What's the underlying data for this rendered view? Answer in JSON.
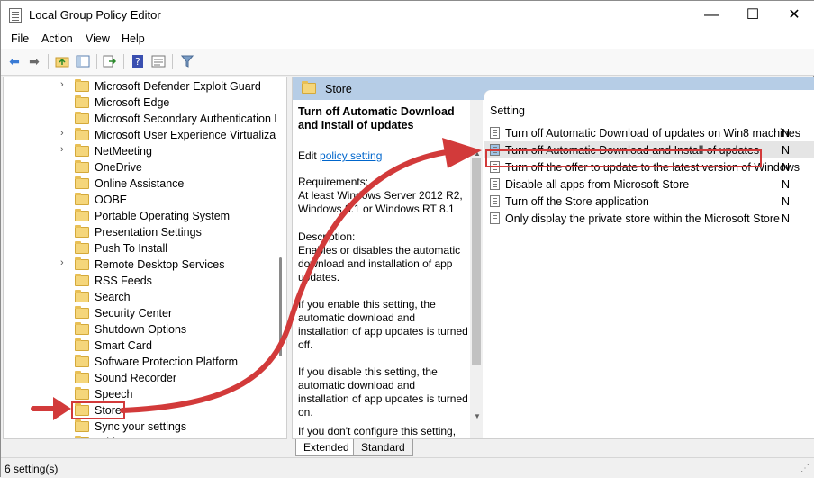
{
  "window": {
    "title": "Local Group Policy Editor",
    "min": "—",
    "max": "☐",
    "close": "✕"
  },
  "menu": [
    "File",
    "Action",
    "View",
    "Help"
  ],
  "toolbar": {
    "back": "back-arrow-icon",
    "forward": "forward-arrow-icon",
    "up": "folder-up-icon",
    "show_hide": "console-tree-icon",
    "export": "export-list-icon",
    "help": "help-icon",
    "properties": "properties-icon",
    "filter": "filter-icon"
  },
  "tree": {
    "items": [
      {
        "label": "Microsoft Defender Exploit Guard",
        "expandable": true
      },
      {
        "label": "Microsoft Edge",
        "expandable": false
      },
      {
        "label": "Microsoft Secondary Authentication F",
        "expandable": false
      },
      {
        "label": "Microsoft User Experience Virtualizati",
        "expandable": true
      },
      {
        "label": "NetMeeting",
        "expandable": true
      },
      {
        "label": "OneDrive",
        "expandable": false
      },
      {
        "label": "Online Assistance",
        "expandable": false
      },
      {
        "label": "OOBE",
        "expandable": false
      },
      {
        "label": "Portable Operating System",
        "expandable": false
      },
      {
        "label": "Presentation Settings",
        "expandable": false
      },
      {
        "label": "Push To Install",
        "expandable": false
      },
      {
        "label": "Remote Desktop Services",
        "expandable": true
      },
      {
        "label": "RSS Feeds",
        "expandable": false
      },
      {
        "label": "Search",
        "expandable": false
      },
      {
        "label": "Security Center",
        "expandable": false
      },
      {
        "label": "Shutdown Options",
        "expandable": false
      },
      {
        "label": "Smart Card",
        "expandable": false
      },
      {
        "label": "Software Protection Platform",
        "expandable": false
      },
      {
        "label": "Sound Recorder",
        "expandable": false
      },
      {
        "label": "Speech",
        "expandable": false
      },
      {
        "label": "Store",
        "expandable": false
      },
      {
        "label": "Sync your settings",
        "expandable": false
      },
      {
        "label": "Tablet PC",
        "expandable": false
      }
    ],
    "selected": "Store"
  },
  "pane": {
    "header": "Store",
    "desc": {
      "title": "Turn off Automatic Download and Install of updates",
      "edit_prefix": "Edit ",
      "edit_link": "policy setting",
      "req_head": "Requirements:",
      "req": "At least Windows Server 2012 R2, Windows 8.1 or Windows RT 8.1",
      "d_head": "Description:",
      "d": "Enables or disables the automatic download and installation of app updates.",
      "p1": "If you enable this setting, the automatic download and installation of app updates is turned off.",
      "p2": "If you disable this setting, the automatic download and installation of app updates is turned on.",
      "p3": "If you don't configure this setting,"
    },
    "list_header": "Setting",
    "settings": [
      {
        "label": "Turn off Automatic Download of updates on Win8 machines",
        "state": "N"
      },
      {
        "label": "Turn off Automatic Download and Install of updates",
        "state": "N"
      },
      {
        "label": "Turn off the offer to update to the latest version of Windows",
        "state": "N"
      },
      {
        "label": "Disable all apps from Microsoft Store",
        "state": "N"
      },
      {
        "label": "Turn off the Store application",
        "state": "N"
      },
      {
        "label": "Only display the private store within the Microsoft Store",
        "state": "N"
      }
    ]
  },
  "tabs": [
    "Extended",
    "Standard"
  ],
  "status": "6 setting(s)",
  "colors": {
    "accent_red": "#d23a3a",
    "header_blue": "#b6cde6",
    "link": "#0066cc"
  }
}
